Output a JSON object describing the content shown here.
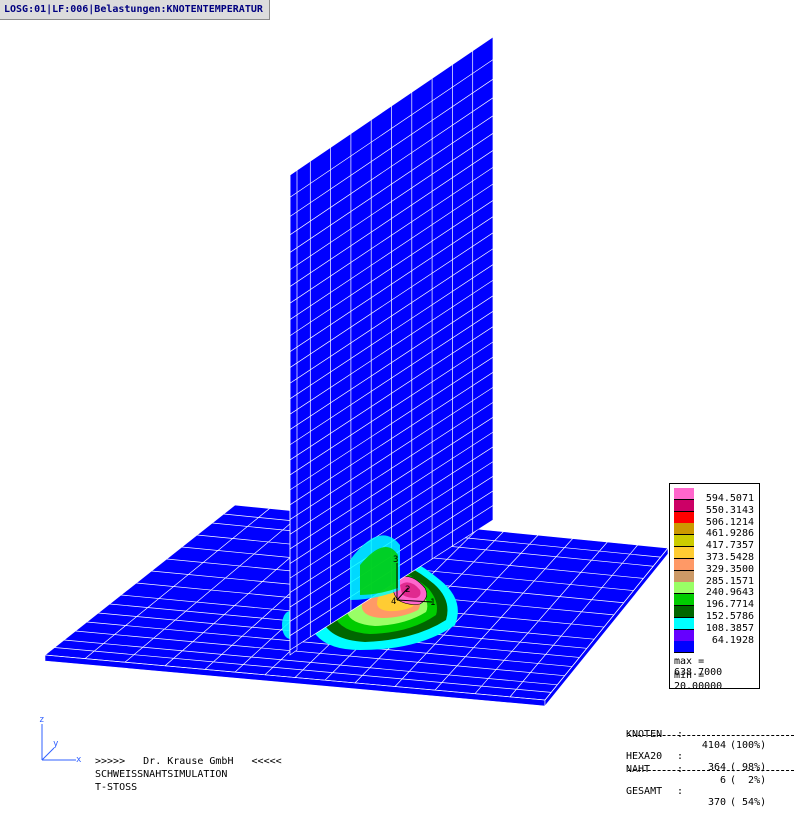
{
  "header": {
    "title": "LOSG:01|LF:006|Belastungen:KNOTENTEMPERATUR"
  },
  "legend": {
    "entries": [
      {
        "value": "594.5071",
        "color": "#ff66cc"
      },
      {
        "value": "550.3143",
        "color": "#cc0066"
      },
      {
        "value": "506.1214",
        "color": "#ff0000"
      },
      {
        "value": "461.9286",
        "color": "#cc9900"
      },
      {
        "value": "417.7357",
        "color": "#cccc00"
      },
      {
        "value": "373.5428",
        "color": "#ffcc33"
      },
      {
        "value": "329.3500",
        "color": "#ff9966"
      },
      {
        "value": "285.1571",
        "color": "#cc9966"
      },
      {
        "value": "240.9643",
        "color": "#99ff66"
      },
      {
        "value": "196.7714",
        "color": "#00cc00"
      },
      {
        "value": "152.5786",
        "color": "#006600"
      },
      {
        "value": "108.3857",
        "color": "#00ffff"
      },
      {
        "value": "64.1928",
        "color": "#6600ff"
      },
      {
        "value": "",
        "color": "#0000ff"
      }
    ],
    "max_label": "max = 638.7000",
    "min_label": "min = 20.00000"
  },
  "stats": {
    "knoten": {
      "label": "KNOTEN",
      "value": "4104",
      "pct": "(100%)"
    },
    "hexa20": {
      "label": "HEXA20",
      "value": "364",
      "pct": "( 98%)"
    },
    "naht": {
      "label": "NAHT",
      "value": "6",
      "pct": "(  2%)"
    },
    "gesamt": {
      "label": "GESAMT",
      "value": "370",
      "pct": "( 54%)"
    }
  },
  "footer": {
    "company": ">>>>>   Dr. Krause GmbH   <<<<<",
    "line1": "SCHWEISSNAHTSIMULATION",
    "line2": "T-STOSS"
  },
  "axes": {
    "x": "x",
    "y": "y",
    "z": "z"
  },
  "node_labels": [
    "1",
    "2",
    "3",
    "4"
  ],
  "colors": {
    "mesh_blue": "#0000ff",
    "mesh_lines": "#ffffff",
    "background": "#ffffff"
  }
}
